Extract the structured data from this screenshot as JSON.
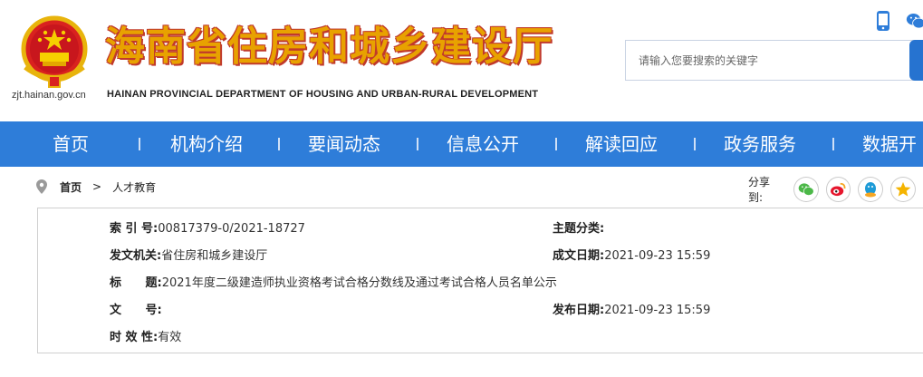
{
  "header": {
    "site_url": "zjt.hainan.gov.cn",
    "title_cn": "海南省住房和城乡建设厅",
    "title_en": "HAINAN PROVINCIAL DEPARTMENT OF HOUSING AND URBAN-RURAL DEVELOPMENT",
    "emblem_icon": "national-emblem-icon",
    "accent_color": "#e8a200"
  },
  "top_icons": [
    "mobile-icon",
    "wechat-icon"
  ],
  "search": {
    "placeholder": "请输入您要搜索的关键字",
    "button_color": "#2673d0"
  },
  "nav": {
    "background": "#2e7dd9",
    "items": [
      {
        "label": "首页"
      },
      {
        "label": "机构介绍"
      },
      {
        "label": "要闻动态"
      },
      {
        "label": "信息公开"
      },
      {
        "label": "解读回应"
      },
      {
        "label": "政务服务"
      },
      {
        "label": "数据开"
      }
    ]
  },
  "breadcrumb": {
    "home": "首页",
    "separator": ">",
    "current": "人才教育"
  },
  "share": {
    "label": "分享到:",
    "targets": [
      "wechat-icon",
      "weibo-icon",
      "qq-icon",
      "qzone-star-icon"
    ]
  },
  "meta": {
    "index_label": "索 引 号:",
    "index_value": "00817379-0/2021-18727",
    "topic_label": "主题分类:",
    "topic_value": "",
    "issuer_label": "发文机关:",
    "issuer_value": "省住房和城乡建设厅",
    "created_label": "成文日期:",
    "created_value": "2021-09-23 15:59",
    "title_label": "标 题:",
    "title_value": "2021年度二级建造师执业资格考试合格分数线及通过考试合格人员名单公示",
    "docno_label": "文 号:",
    "docno_value": "",
    "published_label": "发布日期:",
    "published_value": "2021-09-23 15:59",
    "validity_label": "时 效 性:",
    "validity_value": "有效"
  }
}
